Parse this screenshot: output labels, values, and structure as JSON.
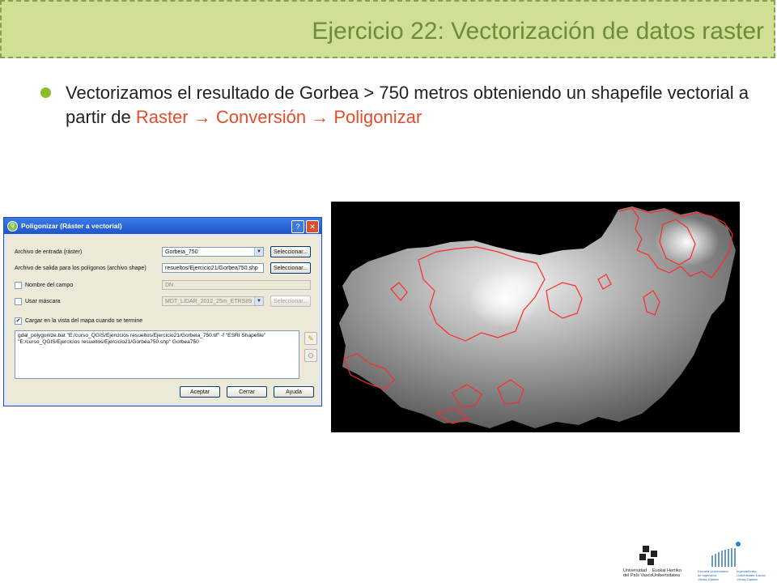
{
  "slide": {
    "title": "Ejercicio 22: Vectorización de datos raster",
    "bullet": {
      "text_before": "Vectorizamos el resultado de Gorbea > 750 metros obteniendo un shapefile vectorial a partir de ",
      "menu_path": "Raster → Conversión → Poligonizar"
    }
  },
  "dialog": {
    "title": "Poligonizar (Ráster a vectorial)",
    "help_label": "?",
    "close_label": "✕",
    "input_label": "Archivo de entrada (ráster)",
    "input_value": "Gorbeia_750",
    "output_label": "Archivo de salida para los polígonos (archivo shape)",
    "output_value": "resueltos/Ejercicio21/Gorbea750.shp",
    "field_name_label": "Nombre del campo",
    "field_name_value": "DN",
    "mask_label": "Usar máscara",
    "mask_value": "MDT_LIDAR_2012_25m_ETRS89",
    "select_label": "Seleccionar...",
    "load_label": "Cargar en la vista del mapa cuando se termine",
    "command_text": "gdal_polygonize.bat \"E:/curso_QGIS/Ejercicios resueltos/Ejercicio21/Gorbeia_750.tif\" -f \"ESRI Shapefile\" \"E:/curso_QGIS/Ejercicios resueltos/Ejercicio21/Gorbea750.shp\" Gorbea750",
    "accept_label": "Aceptar",
    "close_btn_label": "Cerrar",
    "help_btn_label": "Ayuda"
  },
  "logos": {
    "upv_line1": "Universidad",
    "upv_line2": "del País Vasco",
    "ehu_line1": "Euskal Herriko",
    "ehu_line2": "Unibertsitatea",
    "eui_text_1": "Escuela Universitaria",
    "eui_text_2": "de Ingeniería",
    "eui_text_3": "Vitoria-Gasteiz",
    "eui_text_4": "Ingeniaritzako",
    "eui_text_5": "Unibertsitate Eskola",
    "eui_text_6": "Vitoria-Gasteiz"
  },
  "colors": {
    "title_band": "#cfe094",
    "title_text": "#6f8a3a",
    "bullet": "#8dbb2b",
    "highlight": "#e24d2b",
    "outline": "#ff2a2a"
  }
}
